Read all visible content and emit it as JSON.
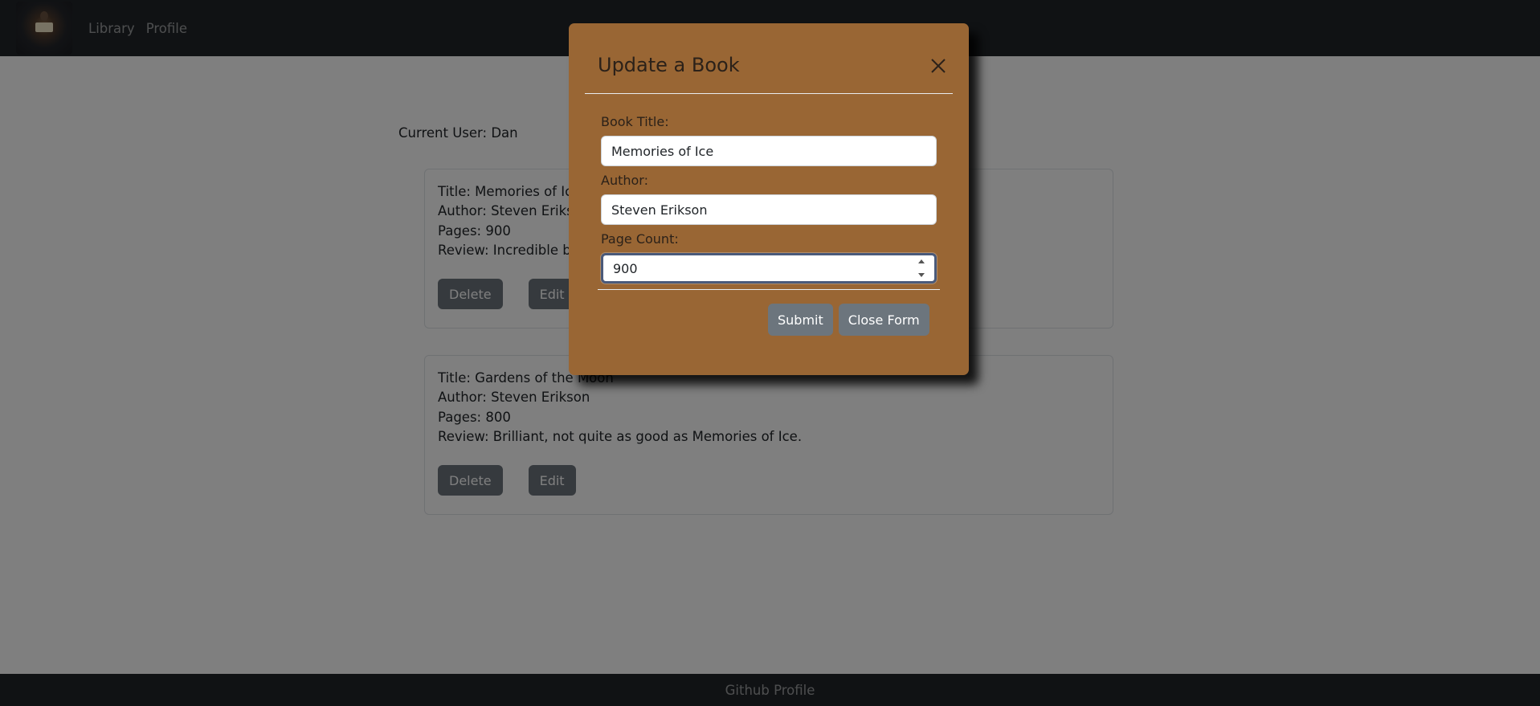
{
  "navbar": {
    "logo_icon": "reading-book-icon",
    "links": [
      {
        "label": "Library"
      },
      {
        "label": "Profile"
      }
    ]
  },
  "page": {
    "current_user_label": "Current User: Dan",
    "books": [
      {
        "title": "Title: Memories of Ice",
        "author": "Author: Steven Erikson",
        "pages": "Pages: 900",
        "review": "Review: Incredible book.",
        "delete_label": "Delete",
        "edit_label": "Edit"
      },
      {
        "title": "Title: Gardens of the Moon",
        "author": "Author: Steven Erikson",
        "pages": "Pages: 800",
        "review": "Review: Brilliant, not quite as good as Memories of Ice.",
        "delete_label": "Delete",
        "edit_label": "Edit"
      }
    ]
  },
  "footer": {
    "link_label": "Github Profile"
  },
  "modal": {
    "title": "Update a Book",
    "close_icon": "close-icon",
    "fields": {
      "title_label": "Book Title:",
      "title_value": "Memories of Ice",
      "author_label": "Author:",
      "author_value": "Steven Erikson",
      "page_count_label": "Page Count:",
      "page_count_value": "900"
    },
    "submit_label": "Submit",
    "close_form_label": "Close Form"
  },
  "colors": {
    "navbar_bg": "#212529",
    "modal_bg": "#996634",
    "button_bg": "#6c757d"
  }
}
